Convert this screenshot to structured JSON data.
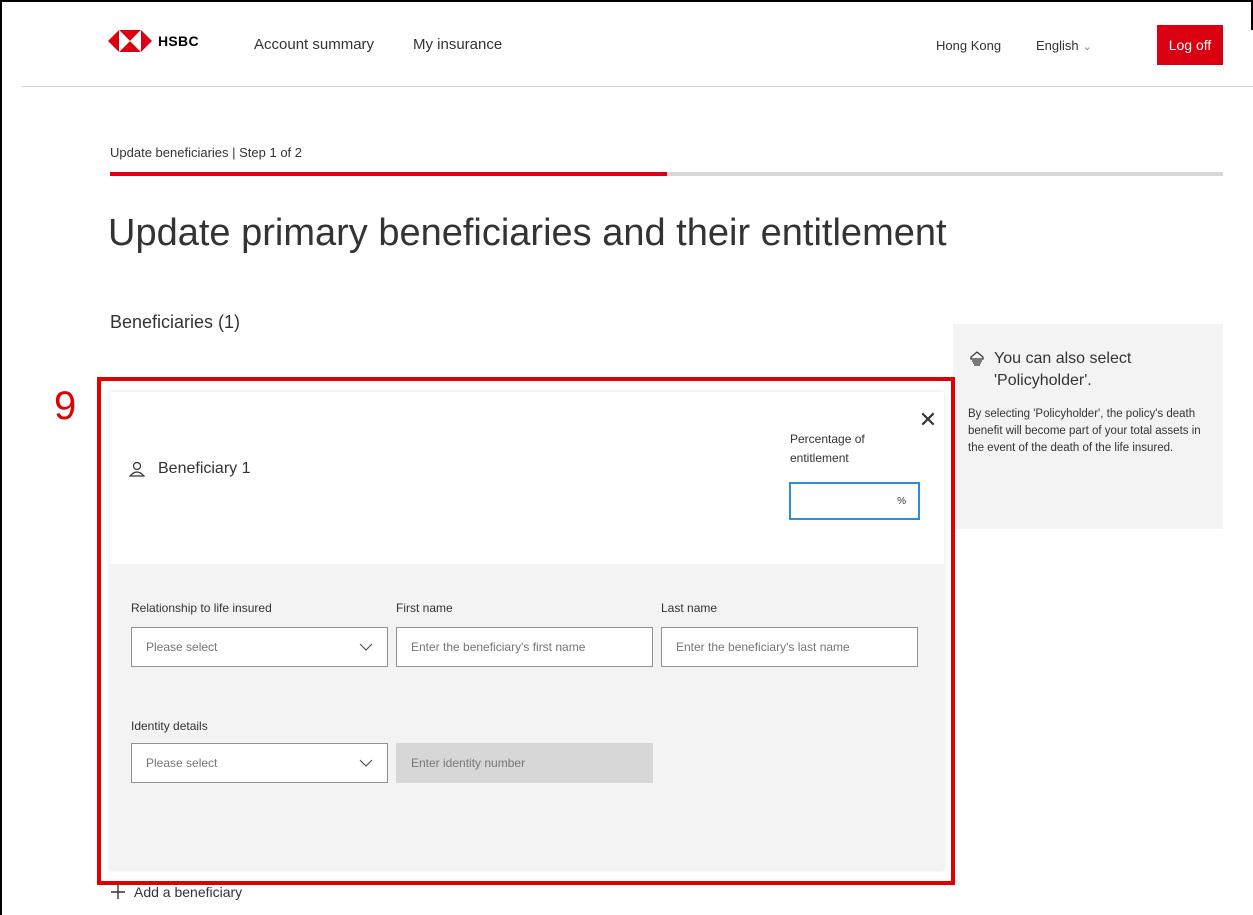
{
  "header": {
    "brand": "HSBC",
    "nav": [
      "Account summary",
      "My insurance"
    ],
    "region": "Hong Kong",
    "language": "English",
    "logoff_label": "Log off"
  },
  "step": {
    "label": "Update beneficiaries | Step 1 of 2",
    "current": 1,
    "total": 2
  },
  "page_title": "Update primary beneficiaries and their entitlement",
  "section_title": "Beneficiaries (1)",
  "info_panel": {
    "heading": "You can also select 'Policyholder'.",
    "body": "By selecting 'Policyholder', the policy's death benefit will become part of your total assets in the event of the death of the life insured."
  },
  "annotation": {
    "number": "9",
    "color": "#e00000"
  },
  "beneficiary_card": {
    "title": "Beneficiary 1",
    "percentage_label": "Percentage of entitlement",
    "percentage_value": "",
    "percentage_unit": "%",
    "relationship": {
      "label": "Relationship to life insured",
      "value": "Please select"
    },
    "first_name": {
      "label": "First name",
      "placeholder": "Enter the beneficiary's first name"
    },
    "last_name": {
      "label": "Last name",
      "placeholder": "Enter the beneficiary's last name"
    },
    "identity": {
      "label": "Identity details",
      "value": "Please select"
    },
    "identity_number": {
      "placeholder": "Enter identity number"
    }
  },
  "add_beneficiary_label": "Add a beneficiary",
  "colors": {
    "brand_red": "#db0011",
    "focus_blue": "#2d8ed8",
    "panel_grey": "#f3f3f3"
  }
}
